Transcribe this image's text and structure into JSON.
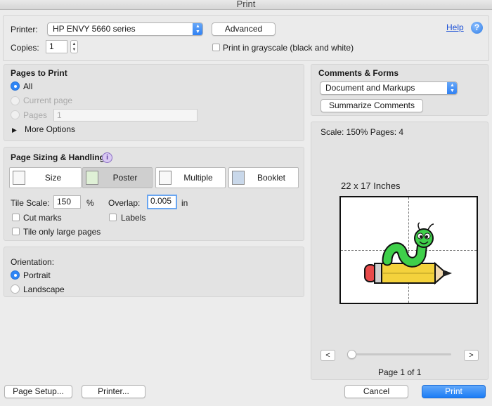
{
  "window": {
    "title": "Print"
  },
  "printer": {
    "label": "Printer:",
    "value": "HP ENVY 5660 series",
    "advanced_label": "Advanced",
    "help_label": "Help"
  },
  "copies": {
    "label": "Copies:",
    "value": "1",
    "grayscale_label": "Print in grayscale (black and white)",
    "grayscale_checked": false
  },
  "pages_to_print": {
    "heading": "Pages to Print",
    "all_label": "All",
    "current_label": "Current page",
    "pages_label": "Pages",
    "pages_value": "1",
    "more_options_label": "More Options",
    "selected": "All"
  },
  "page_sizing": {
    "heading": "Page Sizing & Handling",
    "info_glyph": "i",
    "modes": [
      {
        "label": "Size",
        "selected": false
      },
      {
        "label": "Poster",
        "selected": true
      },
      {
        "label": "Multiple",
        "selected": false
      },
      {
        "label": "Booklet",
        "selected": false
      }
    ],
    "tile_scale_label": "Tile Scale:",
    "tile_scale_value": "150",
    "tile_scale_unit": "%",
    "overlap_label": "Overlap:",
    "overlap_value": "0.005",
    "overlap_unit": "in",
    "cut_marks_label": "Cut marks",
    "labels_label": "Labels",
    "tile_large_label": "Tile only large pages"
  },
  "orientation": {
    "heading": "Orientation:",
    "portrait_label": "Portrait",
    "landscape_label": "Landscape",
    "selected": "Portrait"
  },
  "comments_forms": {
    "heading": "Comments & Forms",
    "value": "Document and Markups",
    "summarize_label": "Summarize Comments"
  },
  "preview": {
    "scale_text": "Scale: 150% Pages: 4",
    "paper_size_text": "22 x 17 Inches",
    "prev_label": "<",
    "next_label": ">",
    "page_indicator": "Page 1 of 1",
    "slider_fraction": 0
  },
  "footer": {
    "page_setup_label": "Page Setup...",
    "printer_label": "Printer...",
    "cancel_label": "Cancel",
    "print_label": "Print"
  },
  "colors": {
    "accent": "#1b7cf5",
    "link": "#1a4fd6",
    "panel": "#e3e3e3"
  }
}
